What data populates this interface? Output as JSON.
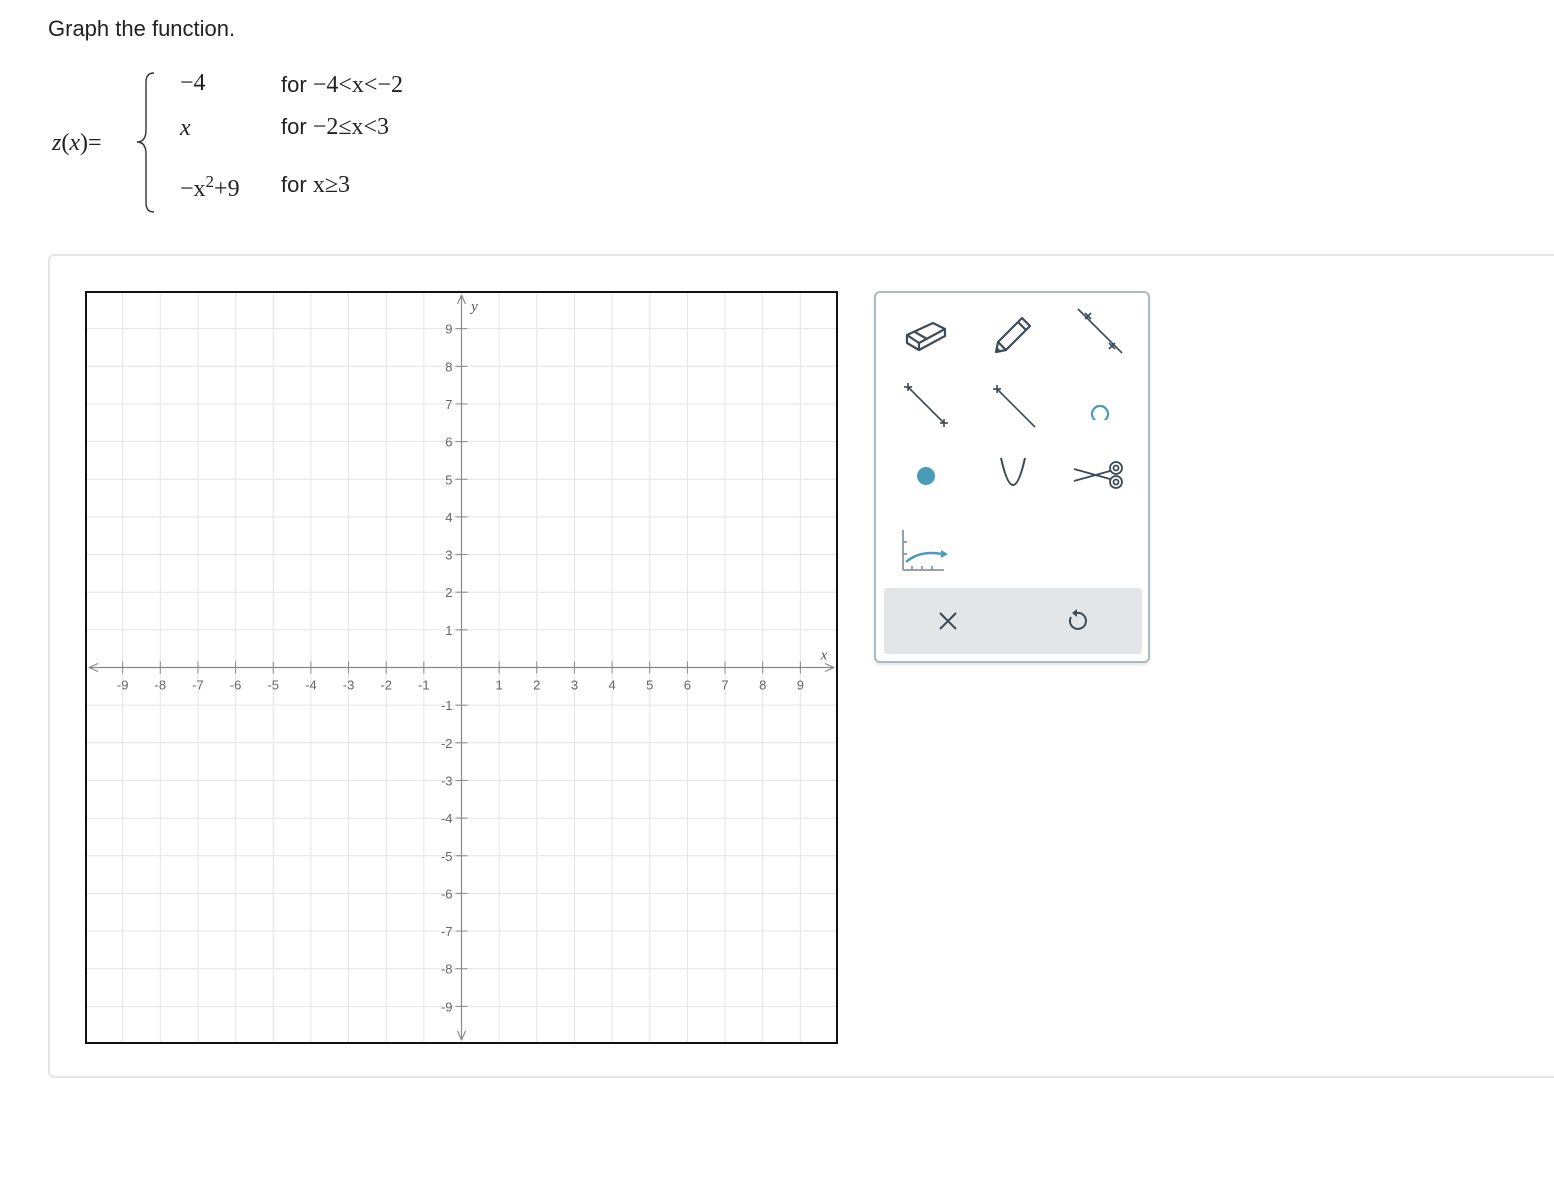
{
  "prompt": "Graph the function.",
  "function": {
    "name": "z",
    "arg": "x",
    "equals": "=",
    "cases": [
      {
        "value": "−4",
        "for_word": "for",
        "condition": "−4<x<−2"
      },
      {
        "value": "x",
        "for_word": "for",
        "condition": "−2≤x<3"
      },
      {
        "value_base": "−x",
        "value_exp": "2",
        "value_rest": "+9",
        "for_word": "for",
        "condition": "x≥3"
      }
    ]
  },
  "graph": {
    "x_axis_label": "x",
    "y_axis_label": "y",
    "xlim": [
      -10,
      10
    ],
    "ylim": [
      -10,
      10
    ],
    "tick_labels_x": [
      "-9",
      "-8",
      "-7",
      "-6",
      "-5",
      "-4",
      "-3",
      "-2",
      "-1",
      "1",
      "2",
      "3",
      "4",
      "5",
      "6",
      "7",
      "8",
      "9"
    ],
    "tick_labels_y": [
      "9",
      "8",
      "7",
      "6",
      "5",
      "4",
      "3",
      "2",
      "1",
      "-1",
      "-2",
      "-3",
      "-4",
      "-5",
      "-6",
      "-7",
      "-8",
      "-9"
    ]
  },
  "toolbox": {
    "tools": [
      "eraser-icon",
      "pencil-icon",
      "line-icon",
      "ray-icon",
      "segment-icon",
      "open-point-icon",
      "closed-point-icon",
      "parabola-icon",
      "scissors-icon",
      "exponential-icon"
    ],
    "footer": [
      "clear-icon",
      "undo-icon"
    ]
  },
  "colors": {
    "accent": "#4a9bb8",
    "tool_stroke": "#3d4b57",
    "grid": "#e6e6e6",
    "toolbox_border": "#a9bac2"
  }
}
